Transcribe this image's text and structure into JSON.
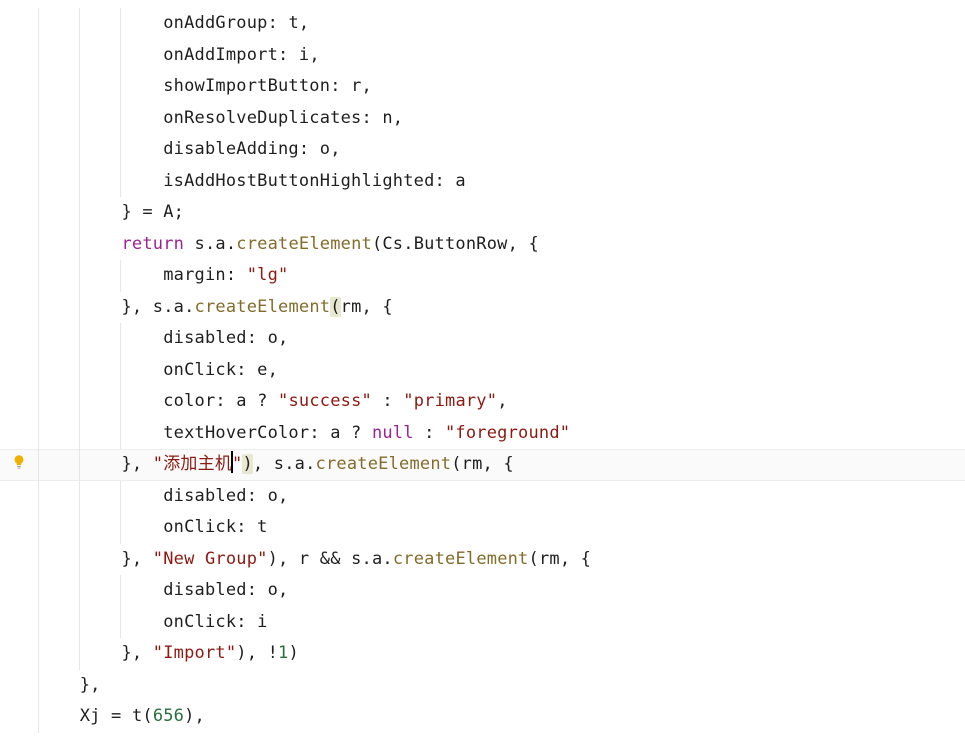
{
  "editor": {
    "language": "javascript",
    "current_line_index": 14,
    "lightbulb_line_index": 14,
    "lines": [
      {
        "indent_guides": 3,
        "indent_spaces": "            ",
        "tokens": [
          {
            "t": "onAddGroup",
            "c": "tk-prop"
          },
          {
            "t": ": ",
            "c": "tk-punc"
          },
          {
            "t": "t",
            "c": "tk-ident"
          },
          {
            "t": ",",
            "c": "tk-punc"
          }
        ]
      },
      {
        "indent_guides": 3,
        "indent_spaces": "            ",
        "tokens": [
          {
            "t": "onAddImport",
            "c": "tk-prop"
          },
          {
            "t": ": ",
            "c": "tk-punc"
          },
          {
            "t": "i",
            "c": "tk-ident"
          },
          {
            "t": ",",
            "c": "tk-punc"
          }
        ]
      },
      {
        "indent_guides": 3,
        "indent_spaces": "            ",
        "tokens": [
          {
            "t": "showImportButton",
            "c": "tk-prop"
          },
          {
            "t": ": ",
            "c": "tk-punc"
          },
          {
            "t": "r",
            "c": "tk-ident"
          },
          {
            "t": ",",
            "c": "tk-punc"
          }
        ]
      },
      {
        "indent_guides": 3,
        "indent_spaces": "            ",
        "tokens": [
          {
            "t": "onResolveDuplicates",
            "c": "tk-prop"
          },
          {
            "t": ": ",
            "c": "tk-punc"
          },
          {
            "t": "n",
            "c": "tk-ident"
          },
          {
            "t": ",",
            "c": "tk-punc"
          }
        ]
      },
      {
        "indent_guides": 3,
        "indent_spaces": "            ",
        "tokens": [
          {
            "t": "disableAdding",
            "c": "tk-prop"
          },
          {
            "t": ": ",
            "c": "tk-punc"
          },
          {
            "t": "o",
            "c": "tk-ident"
          },
          {
            "t": ",",
            "c": "tk-punc"
          }
        ]
      },
      {
        "indent_guides": 3,
        "indent_spaces": "            ",
        "tokens": [
          {
            "t": "isAddHostButtonHighlighted",
            "c": "tk-prop"
          },
          {
            "t": ": ",
            "c": "tk-punc"
          },
          {
            "t": "a",
            "c": "tk-ident"
          }
        ]
      },
      {
        "indent_guides": 2,
        "indent_spaces": "        ",
        "tokens": [
          {
            "t": "} = ",
            "c": "tk-punc"
          },
          {
            "t": "A",
            "c": "tk-ident"
          },
          {
            "t": ";",
            "c": "tk-punc"
          }
        ]
      },
      {
        "indent_guides": 2,
        "indent_spaces": "        ",
        "tokens": [
          {
            "t": "return",
            "c": "tk-keyword"
          },
          {
            "t": " ",
            "c": "tk-punc"
          },
          {
            "t": "s",
            "c": "tk-ident"
          },
          {
            "t": ".",
            "c": "tk-punc"
          },
          {
            "t": "a",
            "c": "tk-ident"
          },
          {
            "t": ".",
            "c": "tk-punc"
          },
          {
            "t": "createElement",
            "c": "tk-call"
          },
          {
            "t": "(",
            "c": "tk-punc"
          },
          {
            "t": "Cs",
            "c": "tk-ident"
          },
          {
            "t": ".",
            "c": "tk-punc"
          },
          {
            "t": "ButtonRow",
            "c": "tk-ident"
          },
          {
            "t": ", {",
            "c": "tk-punc"
          }
        ]
      },
      {
        "indent_guides": 3,
        "indent_spaces": "            ",
        "tokens": [
          {
            "t": "margin",
            "c": "tk-prop"
          },
          {
            "t": ": ",
            "c": "tk-punc"
          },
          {
            "t": "\"lg\"",
            "c": "tk-string"
          }
        ]
      },
      {
        "indent_guides": 2,
        "indent_spaces": "        ",
        "tokens": [
          {
            "t": "}, ",
            "c": "tk-punc"
          },
          {
            "t": "s",
            "c": "tk-ident"
          },
          {
            "t": ".",
            "c": "tk-punc"
          },
          {
            "t": "a",
            "c": "tk-ident"
          },
          {
            "t": ".",
            "c": "tk-punc"
          },
          {
            "t": "createElement",
            "c": "tk-call"
          },
          {
            "t": "(",
            "c": "tk-punc",
            "hl": true
          },
          {
            "t": "rm",
            "c": "tk-ident"
          },
          {
            "t": ", {",
            "c": "tk-punc"
          }
        ]
      },
      {
        "indent_guides": 3,
        "indent_spaces": "            ",
        "tokens": [
          {
            "t": "disabled",
            "c": "tk-prop"
          },
          {
            "t": ": ",
            "c": "tk-punc"
          },
          {
            "t": "o",
            "c": "tk-ident"
          },
          {
            "t": ",",
            "c": "tk-punc"
          }
        ]
      },
      {
        "indent_guides": 3,
        "indent_spaces": "            ",
        "tokens": [
          {
            "t": "onClick",
            "c": "tk-prop"
          },
          {
            "t": ": ",
            "c": "tk-punc"
          },
          {
            "t": "e",
            "c": "tk-ident"
          },
          {
            "t": ",",
            "c": "tk-punc"
          }
        ]
      },
      {
        "indent_guides": 3,
        "indent_spaces": "            ",
        "tokens": [
          {
            "t": "color",
            "c": "tk-prop"
          },
          {
            "t": ": ",
            "c": "tk-punc"
          },
          {
            "t": "a",
            "c": "tk-ident"
          },
          {
            "t": " ? ",
            "c": "tk-punc"
          },
          {
            "t": "\"success\"",
            "c": "tk-string"
          },
          {
            "t": " : ",
            "c": "tk-punc"
          },
          {
            "t": "\"primary\"",
            "c": "tk-string"
          },
          {
            "t": ",",
            "c": "tk-punc"
          }
        ]
      },
      {
        "indent_guides": 3,
        "indent_spaces": "            ",
        "tokens": [
          {
            "t": "textHoverColor",
            "c": "tk-prop"
          },
          {
            "t": ": ",
            "c": "tk-punc"
          },
          {
            "t": "a",
            "c": "tk-ident"
          },
          {
            "t": " ? ",
            "c": "tk-punc"
          },
          {
            "t": "null",
            "c": "tk-null"
          },
          {
            "t": " : ",
            "c": "tk-punc"
          },
          {
            "t": "\"foreground\"",
            "c": "tk-string"
          }
        ]
      },
      {
        "indent_guides": 2,
        "indent_spaces": "        ",
        "current": true,
        "tokens": [
          {
            "t": "}, ",
            "c": "tk-punc"
          },
          {
            "t": "\"添加主机",
            "c": "tk-string"
          },
          {
            "caret": true
          },
          {
            "t": "\"",
            "c": "tk-string"
          },
          {
            "t": ")",
            "c": "tk-punc",
            "hl": true
          },
          {
            "t": ", ",
            "c": "tk-punc"
          },
          {
            "t": "s",
            "c": "tk-ident"
          },
          {
            "t": ".",
            "c": "tk-punc"
          },
          {
            "t": "a",
            "c": "tk-ident"
          },
          {
            "t": ".",
            "c": "tk-punc"
          },
          {
            "t": "createElement",
            "c": "tk-call"
          },
          {
            "t": "(",
            "c": "tk-punc"
          },
          {
            "t": "rm",
            "c": "tk-ident"
          },
          {
            "t": ", {",
            "c": "tk-punc"
          }
        ]
      },
      {
        "indent_guides": 3,
        "indent_spaces": "            ",
        "tokens": [
          {
            "t": "disabled",
            "c": "tk-prop"
          },
          {
            "t": ": ",
            "c": "tk-punc"
          },
          {
            "t": "o",
            "c": "tk-ident"
          },
          {
            "t": ",",
            "c": "tk-punc"
          }
        ]
      },
      {
        "indent_guides": 3,
        "indent_spaces": "            ",
        "tokens": [
          {
            "t": "onClick",
            "c": "tk-prop"
          },
          {
            "t": ": ",
            "c": "tk-punc"
          },
          {
            "t": "t",
            "c": "tk-ident"
          }
        ]
      },
      {
        "indent_guides": 2,
        "indent_spaces": "        ",
        "tokens": [
          {
            "t": "}, ",
            "c": "tk-punc"
          },
          {
            "t": "\"New Group\"",
            "c": "tk-string"
          },
          {
            "t": "), ",
            "c": "tk-punc"
          },
          {
            "t": "r",
            "c": "tk-ident"
          },
          {
            "t": " && ",
            "c": "tk-punc"
          },
          {
            "t": "s",
            "c": "tk-ident"
          },
          {
            "t": ".",
            "c": "tk-punc"
          },
          {
            "t": "a",
            "c": "tk-ident"
          },
          {
            "t": ".",
            "c": "tk-punc"
          },
          {
            "t": "createElement",
            "c": "tk-call"
          },
          {
            "t": "(",
            "c": "tk-punc"
          },
          {
            "t": "rm",
            "c": "tk-ident"
          },
          {
            "t": ", {",
            "c": "tk-punc"
          }
        ]
      },
      {
        "indent_guides": 3,
        "indent_spaces": "            ",
        "tokens": [
          {
            "t": "disabled",
            "c": "tk-prop"
          },
          {
            "t": ": ",
            "c": "tk-punc"
          },
          {
            "t": "o",
            "c": "tk-ident"
          },
          {
            "t": ",",
            "c": "tk-punc"
          }
        ]
      },
      {
        "indent_guides": 3,
        "indent_spaces": "            ",
        "tokens": [
          {
            "t": "onClick",
            "c": "tk-prop"
          },
          {
            "t": ": ",
            "c": "tk-punc"
          },
          {
            "t": "i",
            "c": "tk-ident"
          }
        ]
      },
      {
        "indent_guides": 2,
        "indent_spaces": "        ",
        "tokens": [
          {
            "t": "}, ",
            "c": "tk-punc"
          },
          {
            "t": "\"Import\"",
            "c": "tk-string"
          },
          {
            "t": "), !",
            "c": "tk-punc"
          },
          {
            "t": "1",
            "c": "tk-number"
          },
          {
            "t": ")",
            "c": "tk-punc"
          }
        ]
      },
      {
        "indent_guides": 1,
        "indent_spaces": "    ",
        "tokens": [
          {
            "t": "},",
            "c": "tk-punc"
          }
        ]
      },
      {
        "indent_guides": 1,
        "indent_spaces": "    ",
        "tokens": [
          {
            "t": "Xj",
            "c": "tk-ident"
          },
          {
            "t": " = ",
            "c": "tk-punc"
          },
          {
            "t": "t",
            "c": "tk-ident"
          },
          {
            "t": "(",
            "c": "tk-punc"
          },
          {
            "t": "656",
            "c": "tk-number"
          },
          {
            "t": "),",
            "c": "tk-punc"
          }
        ]
      }
    ]
  }
}
